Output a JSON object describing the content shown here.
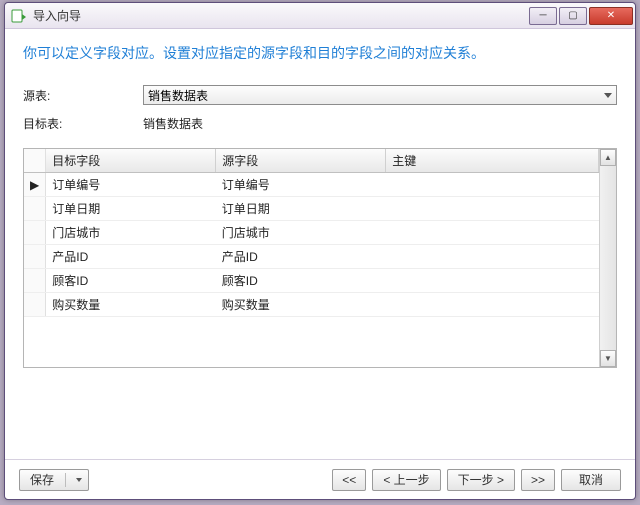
{
  "window": {
    "title": "导入向导"
  },
  "instruction": "你可以定义字段对应。设置对应指定的源字段和目的字段之间的对应关系。",
  "form": {
    "source_label": "源表:",
    "source_value": "销售数据表",
    "target_label": "目标表:",
    "target_value": "销售数据表"
  },
  "table": {
    "headers": {
      "target": "目标字段",
      "source": "源字段",
      "pk": "主键"
    },
    "rows": [
      {
        "indicator": "▶",
        "target": "订单编号",
        "source": "订单编号",
        "pk": ""
      },
      {
        "indicator": "",
        "target": "订单日期",
        "source": "订单日期",
        "pk": ""
      },
      {
        "indicator": "",
        "target": "门店城市",
        "source": "门店城市",
        "pk": ""
      },
      {
        "indicator": "",
        "target": "产品ID",
        "source": "产品ID",
        "pk": ""
      },
      {
        "indicator": "",
        "target": "顾客ID",
        "source": "顾客ID",
        "pk": ""
      },
      {
        "indicator": "",
        "target": "购买数量",
        "source": "购买数量",
        "pk": ""
      }
    ]
  },
  "footer": {
    "save": "保存",
    "first": "<<",
    "prev": "< 上一步",
    "next": "下一步 >",
    "last": ">>",
    "cancel": "取消"
  }
}
